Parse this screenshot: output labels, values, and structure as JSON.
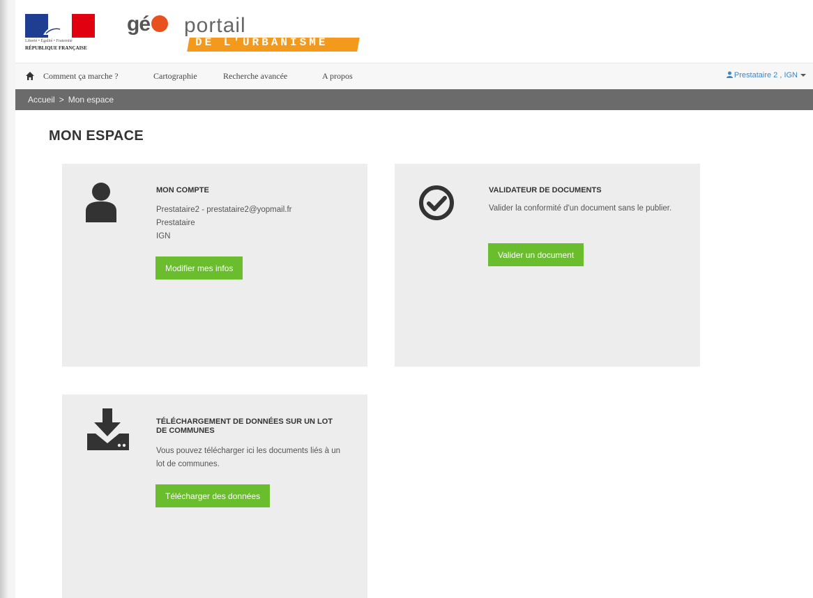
{
  "header": {
    "rf_motto": "Liberté • Égalité • Fraternité",
    "rf_name": "RÉPUBLIQUE FRANÇAISE",
    "logo_geo": "gé",
    "logo_portail": "portail",
    "logo_urba": "DE L'URBANISME"
  },
  "nav": {
    "items": [
      {
        "label": "Comment ça marche ?"
      },
      {
        "label": "Cartographie"
      },
      {
        "label": "Recherche avancée"
      },
      {
        "label": "A propos"
      }
    ],
    "user_label": "Prestataire 2 , IGN"
  },
  "breadcrumb": {
    "home": "Accueil",
    "separator": ">",
    "current": "Mon espace"
  },
  "page": {
    "title": "MON ESPACE"
  },
  "cards": {
    "compte": {
      "title": "MON COMPTE",
      "line1": "Prestataire2 - prestataire2@yopmail.fr",
      "line2": "Prestataire",
      "line3": "IGN",
      "button": "Modifier mes infos"
    },
    "validateur": {
      "title": "VALIDATEUR DE DOCUMENTS",
      "text": "Valider la conformité d'un document sans le publier.",
      "button": "Valider un document"
    },
    "telechargement": {
      "title": "TÉLÉCHARGEMENT DE DONNÉES SUR UN LOT DE COMMUNES",
      "text": "Vous pouvez télécharger ici les documents liés à un lot de communes.",
      "button": "Télécharger des données"
    }
  },
  "colors": {
    "accent_green": "#6abe2e",
    "breadcrumb_bg": "#6b6b6b",
    "card_bg": "#ededed",
    "user_link": "#3a87c8"
  }
}
